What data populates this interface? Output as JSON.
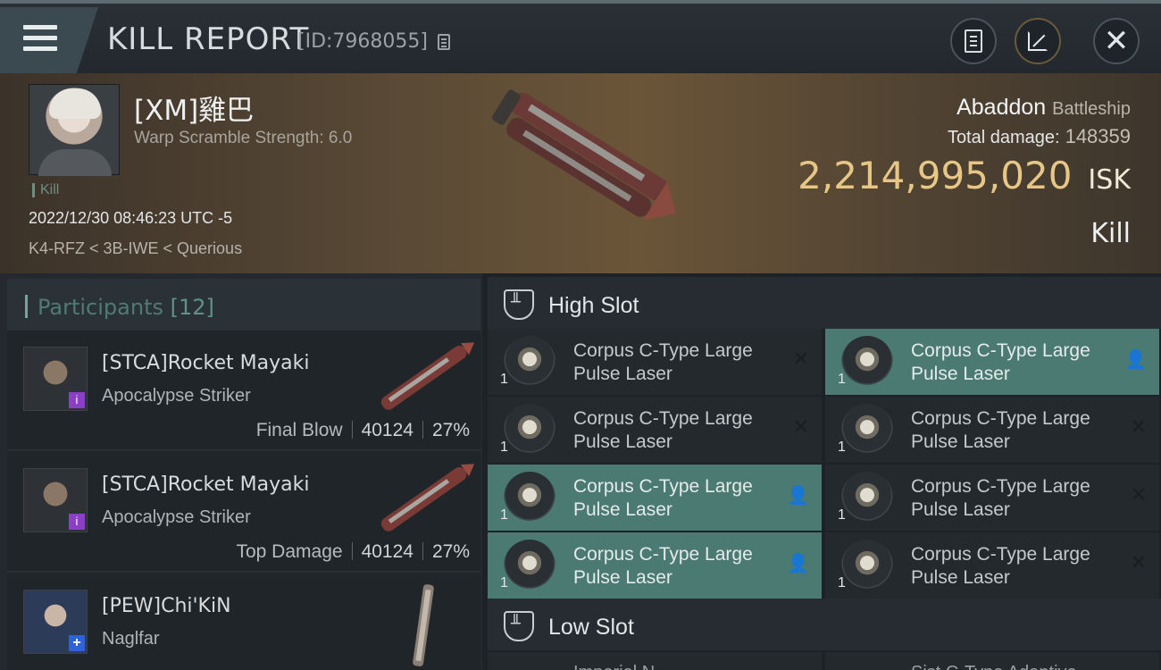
{
  "header": {
    "title": "KILL REPORT",
    "report_id": "[ID:7968055]",
    "icons": [
      "menu-icon",
      "copy-icon",
      "clipboard-icon",
      "share-icon",
      "close-icon"
    ]
  },
  "victim": {
    "name": "[XM]雞巴",
    "warp_scramble": "Warp Scramble Strength: 6.0",
    "tag": "Kill",
    "datetime": "2022/12/30 08:46:23 UTC -5",
    "location": "K4-RFZ < 3B-IWE < Querious",
    "ship_name": "Abaddon",
    "ship_class": "Battleship",
    "total_damage_label": "Total damage:",
    "total_damage": "148359",
    "isk_value": "2,214,995,020",
    "isk_unit": "ISK",
    "kill_type": "Kill"
  },
  "participants": {
    "label": "Participants",
    "count": "[12]",
    "rows": [
      {
        "name": "[STCA]Rocket Mayaki",
        "ship": "Apocalypse Striker",
        "role": "Final Blow",
        "damage": "40124",
        "percent": "27%"
      },
      {
        "name": "[STCA]Rocket Mayaki",
        "ship": "Apocalypse Striker",
        "role": "Top Damage",
        "damage": "40124",
        "percent": "27%"
      },
      {
        "name": "[PEW]Chi'KiN",
        "ship": "Naglfar",
        "role": "",
        "damage": "",
        "percent": ""
      }
    ]
  },
  "slots": {
    "high_label": "High Slot",
    "low_label": "Low Slot",
    "high_modules": [
      {
        "name": "Corpus C-Type Large Pulse Laser",
        "qty": "1",
        "status": "destroyed"
      },
      {
        "name": "Corpus C-Type Large Pulse Laser",
        "qty": "1",
        "status": "dropped"
      },
      {
        "name": "Corpus C-Type Large Pulse Laser",
        "qty": "1",
        "status": "destroyed"
      },
      {
        "name": "Corpus C-Type Large Pulse Laser",
        "qty": "1",
        "status": "destroyed"
      },
      {
        "name": "Corpus C-Type Large Pulse Laser",
        "qty": "1",
        "status": "dropped"
      },
      {
        "name": "Corpus C-Type Large Pulse Laser",
        "qty": "1",
        "status": "destroyed"
      },
      {
        "name": "Corpus C-Type Large Pulse Laser",
        "qty": "1",
        "status": "dropped"
      },
      {
        "name": "Corpus C-Type Large Pulse Laser",
        "qty": "1",
        "status": "destroyed"
      }
    ],
    "low_modules_partial": [
      "Imperial N",
      "Sist C-Type Adaptive"
    ]
  },
  "colors": {
    "isk_gold": "#e7c786",
    "dropped_teal": "#4a7a72",
    "accent_teal": "#74a79a",
    "badge_purple": "#8b3ec6",
    "badge_blue": "#2f62d6"
  }
}
